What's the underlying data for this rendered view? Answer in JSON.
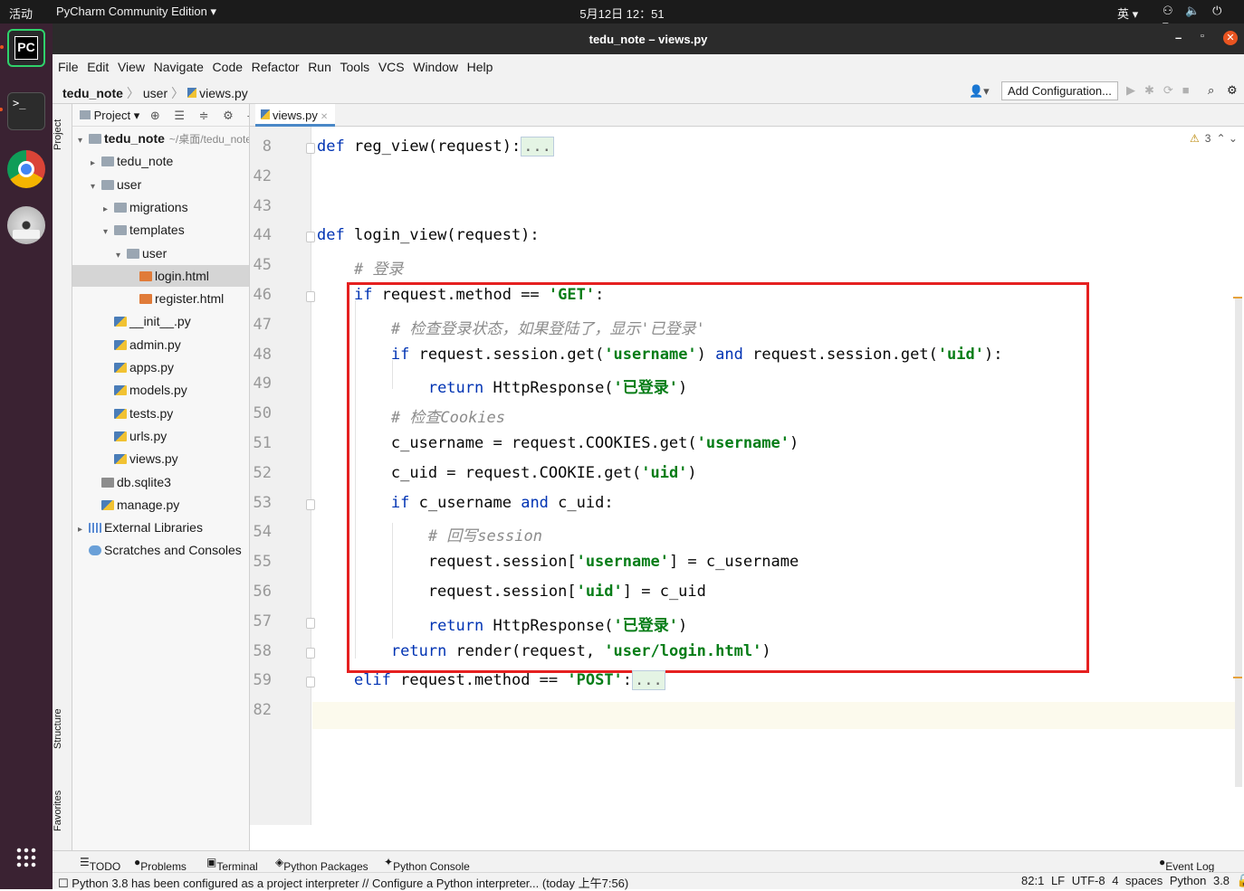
{
  "topbar": {
    "activities": "活动",
    "app_name": "PyCharm Community Edition",
    "datetime": "5月12日  12：51",
    "input_method": "英",
    "system_icons": "network-icon volume-icon power-icon"
  },
  "window": {
    "title": "tedu_note – views.py",
    "minimize": "–",
    "maximize": "▫",
    "close": "✕"
  },
  "menu": [
    "File",
    "Edit",
    "View",
    "Navigate",
    "Code",
    "Refactor",
    "Run",
    "Tools",
    "VCS",
    "Window",
    "Help"
  ],
  "nav": {
    "project": "tedu_note",
    "folder": "user",
    "file": "views.py",
    "add_configuration": "Add Configuration..."
  },
  "side_tabs": {
    "project": "Project",
    "structure": "Structure",
    "favorites": "Favorites"
  },
  "project_panel": {
    "title": "Project",
    "root_hint": "~/桌面/tedu_note",
    "tree": [
      {
        "label": "tedu_note",
        "depth": 0,
        "icon": "dir",
        "arrow": "▾",
        "bold": true
      },
      {
        "label": "tedu_note",
        "depth": 1,
        "icon": "dir",
        "arrow": "▸"
      },
      {
        "label": "user",
        "depth": 1,
        "icon": "dir",
        "arrow": "▾"
      },
      {
        "label": "migrations",
        "depth": 2,
        "icon": "dir",
        "arrow": "▸"
      },
      {
        "label": "templates",
        "depth": 2,
        "icon": "dir",
        "arrow": "▾"
      },
      {
        "label": "user",
        "depth": 3,
        "icon": "dir",
        "arrow": "▾"
      },
      {
        "label": "login.html",
        "depth": 4,
        "icon": "html",
        "selected": true
      },
      {
        "label": "register.html",
        "depth": 4,
        "icon": "html"
      },
      {
        "label": "__init__.py",
        "depth": 2,
        "icon": "py"
      },
      {
        "label": "admin.py",
        "depth": 2,
        "icon": "py"
      },
      {
        "label": "apps.py",
        "depth": 2,
        "icon": "py"
      },
      {
        "label": "models.py",
        "depth": 2,
        "icon": "py"
      },
      {
        "label": "tests.py",
        "depth": 2,
        "icon": "py"
      },
      {
        "label": "urls.py",
        "depth": 2,
        "icon": "py"
      },
      {
        "label": "views.py",
        "depth": 2,
        "icon": "py"
      },
      {
        "label": "db.sqlite3",
        "depth": 1,
        "icon": "db"
      },
      {
        "label": "manage.py",
        "depth": 1,
        "icon": "py"
      },
      {
        "label": "External Libraries",
        "depth": 0,
        "icon": "lib",
        "arrow": "▸"
      },
      {
        "label": "Scratches and Consoles",
        "depth": 0,
        "icon": "scr"
      }
    ]
  },
  "editor": {
    "tab": "views.py",
    "warnings": "3",
    "lines": [
      {
        "n": "8",
        "html": "<span class='kw'>def</span> reg_view(request):<span class='dots'>...</span>"
      },
      {
        "n": "42",
        "html": ""
      },
      {
        "n": "43",
        "html": ""
      },
      {
        "n": "44",
        "html": "<span class='kw'>def</span> login_view(request):"
      },
      {
        "n": "45",
        "html": "    <span class='cm'># 登录</span>"
      },
      {
        "n": "46",
        "html": "    <span class='kw'>if</span> request.method == <span class='str'>'GET'</span>:"
      },
      {
        "n": "47",
        "html": "        <span class='cm'># 检查登录状态，如果登陆了，显示'已登录'</span>"
      },
      {
        "n": "48",
        "html": "        <span class='kw'>if</span> request.session.get(<span class='str'>'username'</span>) <span class='kw'>and</span> request.session.get(<span class='str'>'uid'</span>):"
      },
      {
        "n": "49",
        "html": "            <span class='kw'>return</span> HttpResponse(<span class='str'>'已登录'</span>)"
      },
      {
        "n": "50",
        "html": "        <span class='cm'># 检查Cookies</span>"
      },
      {
        "n": "51",
        "html": "        c_username = request.COOKIES.get(<span class='str'>'username'</span>)"
      },
      {
        "n": "52",
        "html": "        c_uid = request.COOKIE.get(<span class='str'>'uid'</span>)"
      },
      {
        "n": "53",
        "html": "        <span class='kw'>if</span> c_username <span class='kw'>and</span> c_uid:"
      },
      {
        "n": "54",
        "html": "            <span class='cm'># 回写session</span>"
      },
      {
        "n": "55",
        "html": "            request.session[<span class='str'>'username'</span>] = c_username"
      },
      {
        "n": "56",
        "html": "            request.session[<span class='str'>'uid'</span>] = c_uid"
      },
      {
        "n": "57",
        "html": "            <span class='kw'>return</span> HttpResponse(<span class='str'>'已登录'</span>)"
      },
      {
        "n": "58",
        "html": "        <span class='kw'>return</span> render(request, <span class='str'>'user/login.html'</span>)"
      },
      {
        "n": "59",
        "html": "    <span class='kw'>elif</span> request.method == <span class='str'>'POST'</span>:<span class='dots'>...</span>"
      },
      {
        "n": "82",
        "html": ""
      }
    ]
  },
  "bottom_tabs": [
    "TODO",
    "Problems",
    "Terminal",
    "Python Packages",
    "Python Console"
  ],
  "event_log": "Event Log",
  "status": {
    "message": "Python 3.8 has been configured as a project interpreter // Configure a Python interpreter... (today 上午7:56)",
    "position": "82:1",
    "line_sep": "LF",
    "encoding": "UTF-8",
    "indent": "4 spaces",
    "interpreter": "Python 3.8"
  }
}
